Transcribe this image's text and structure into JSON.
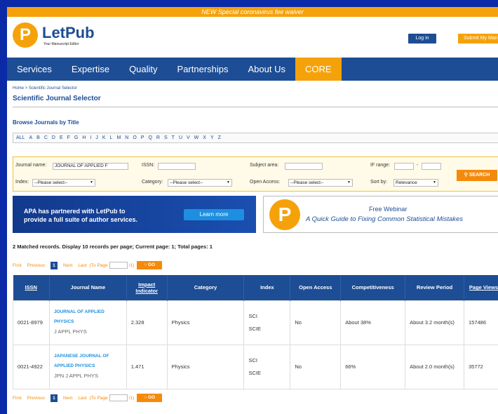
{
  "banner": "NEW Special coronavirus fee waiver",
  "logo": {
    "glyph": "P",
    "name": "LetPub",
    "tagline": "Your Manuscript Editor"
  },
  "header": {
    "login": "Log in",
    "submit": "Submit My Manuscript"
  },
  "nav": [
    "Services",
    "Expertise",
    "Quality",
    "Partnerships",
    "About Us",
    "CORE"
  ],
  "breadcrumb": "Home > Scientific Journal Selector",
  "page_title": "Scientific Journal Selector",
  "browse_title": "Browse Journals by Title",
  "alphabet": [
    "ALL",
    "A",
    "B",
    "C",
    "D",
    "E",
    "F",
    "G",
    "H",
    "I",
    "J",
    "K",
    "L",
    "M",
    "N",
    "O",
    "P",
    "Q",
    "R",
    "S",
    "T",
    "U",
    "V",
    "W",
    "X",
    "Y",
    "Z"
  ],
  "search": {
    "journal_label": "Journal name:",
    "journal_value": "JOURNAL OF APPLIED F",
    "issn_label": "ISSN:",
    "issn_value": "",
    "subject_label": "Subject area:",
    "subject_value": "",
    "if_label": "IF range:",
    "if_min": "",
    "if_sep": "-",
    "if_max": "",
    "index_label": "Index:",
    "index_value": "--Please select--",
    "category_label": "Category:",
    "category_value": "--Please select--",
    "oa_label": "Open Access:",
    "oa_value": "--Please select--",
    "sort_label": "Sort by:",
    "sort_value": "Relevance",
    "button": "SEARCH"
  },
  "promo": {
    "text_line1": "APA has partnered with LetPub to",
    "text_line2": "provide a full suite of author services.",
    "button": "Learn more"
  },
  "webinar": {
    "glyph": "P",
    "title": "Free Webinar",
    "subtitle": "A Quick Guide to Fixing Common Statistical Mistakes"
  },
  "matched": "2 Matched records. Display 10 records per page; Current page: 1; Total pages: 1",
  "pager": {
    "first": "First",
    "previous": "Previous",
    "current": "1",
    "next": "Next",
    "last": "Last",
    "to_page": "(To Page",
    "total": "/1)",
    "go": "GO"
  },
  "table": {
    "headers": [
      "ISSN",
      "Journal Name",
      "Impact Indicator",
      "Category",
      "Index",
      "Open Access",
      "Competitiveness",
      "Review Period",
      "Page Views"
    ],
    "rows": [
      {
        "issn": "0021-8979",
        "name1": "JOURNAL OF APPLIED",
        "name2": "PHYSICS",
        "abbr": "J APPL PHYS",
        "impact": "2.328",
        "category": "Physics",
        "index1": "SCI",
        "index2": "SCIE",
        "oa": "No",
        "competitiveness": "About 38%",
        "review": "About 3.2 month(s)",
        "views": "157486"
      },
      {
        "issn": "0021-4922",
        "name1": "JAPANESE JOURNAL OF",
        "name2": "APPLIED PHYSICS",
        "abbr": "JPN J APPL PHYS",
        "impact": "1.471",
        "category": "Physics",
        "index1": "SCI",
        "index2": "SCIE",
        "oa": "No",
        "competitiveness": "66%",
        "review": "About 2.0 month(s)",
        "views": "35772"
      }
    ]
  },
  "colors": {
    "navy": "#1d4d94",
    "orange": "#f5a20a",
    "link": "#1d8fe0",
    "frame": "#0a2aa8"
  }
}
